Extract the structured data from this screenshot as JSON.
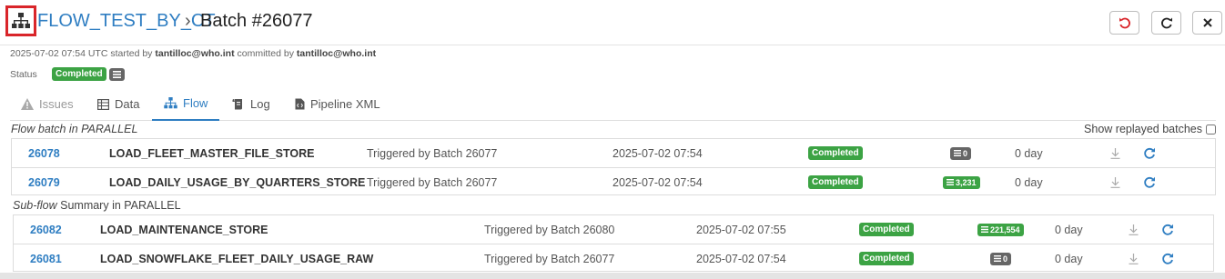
{
  "header": {
    "flow_name": "FLOW_TEST_BY_CT",
    "separator": "›",
    "batch_title": "Batch #26077",
    "icons": [
      "sitemap-icon",
      "undo-icon",
      "redo-icon",
      "close-icon"
    ]
  },
  "meta": {
    "date": "2025-07-02 07:54",
    "utc_started_by": "UTC started by",
    "starter": "tantilloc@who.int",
    "committed_by": "committed by",
    "committer": "tantilloc@who.int",
    "status_label": "Status",
    "status_value": "Completed"
  },
  "tabs": [
    {
      "label": "Issues",
      "icon": "warning-icon"
    },
    {
      "label": "Data",
      "icon": "table-icon"
    },
    {
      "label": "Flow",
      "icon": "sitemap-icon"
    },
    {
      "label": "Log",
      "icon": "scroll-icon"
    },
    {
      "label": "Pipeline XML",
      "icon": "code-file-icon"
    }
  ],
  "flow_section": {
    "title_italic": "Flow batch in PARALLEL",
    "title_rest": "",
    "show_replayed_label": "Show replayed batches",
    "rows": [
      {
        "id": "26078",
        "name": "LOAD_FLEET_MASTER_FILE_STORE",
        "trigger": "Triggered by Batch 26077",
        "time": "2025-07-02 07:54",
        "status": "Completed",
        "count": "0",
        "duration": "0 day"
      },
      {
        "id": "26079",
        "name": "LOAD_DAILY_USAGE_BY_QUARTERS_STORE",
        "trigger": "Triggered by Batch 26077",
        "time": "2025-07-02 07:54",
        "status": "Completed",
        "count": "3,231",
        "duration": "0 day"
      }
    ]
  },
  "subflow_section": {
    "title_italic": "Sub-flow",
    "title_rest": " Summary in PARALLEL",
    "rows": [
      {
        "id": "26082",
        "name": "LOAD_MAINTENANCE_STORE",
        "trigger": "Triggered by Batch 26080",
        "time": "2025-07-02 07:55",
        "status": "Completed",
        "count": "221,554",
        "duration": "0 day"
      },
      {
        "id": "26081",
        "name": "LOAD_SNOWFLAKE_FLEET_DAILY_USAGE_RAW",
        "trigger": "Triggered by Batch 26077",
        "time": "2025-07-02 07:54",
        "status": "Completed",
        "count": "0",
        "duration": "0 day"
      }
    ]
  },
  "colors": {
    "accent": "#2f7ec2",
    "success": "#3ca344",
    "neutral": "#666666",
    "highlight": "#d9252a"
  }
}
